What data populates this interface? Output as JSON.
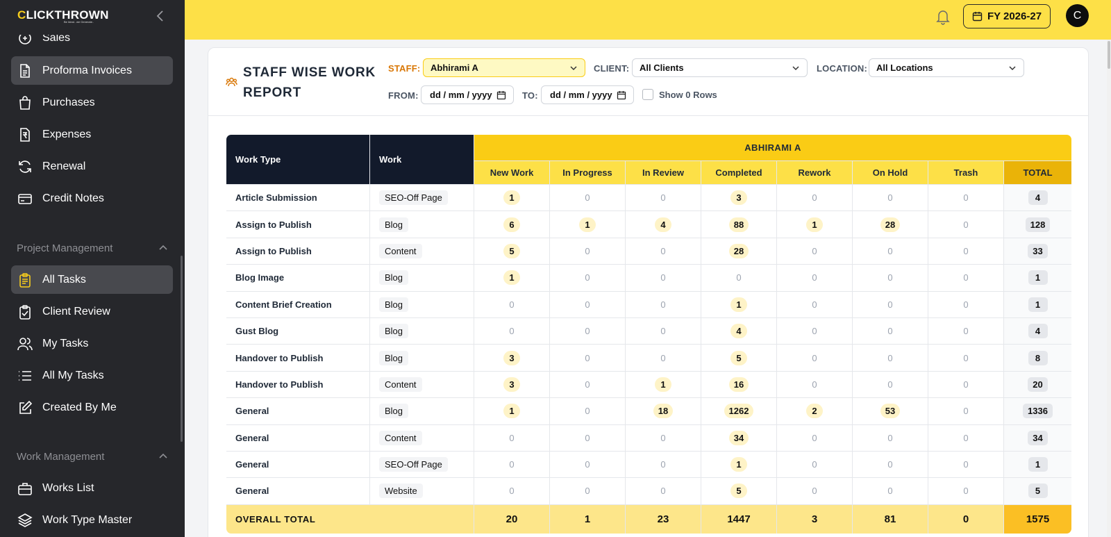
{
  "brand": {
    "logo_first": "C",
    "logo_rest": "LICKTHROWN",
    "tagline": "Be Ideal.. we Generate.."
  },
  "sidebar": {
    "partial_item": "Sales",
    "items_top": [
      {
        "label": "Proforma Invoices",
        "icon": "document-icon",
        "active": true
      },
      {
        "label": "Purchases",
        "icon": "shopping-bag-icon"
      },
      {
        "label": "Expenses",
        "icon": "rupee-receipt-icon"
      },
      {
        "label": "Renewal",
        "icon": "refresh-icon"
      },
      {
        "label": "Credit Notes",
        "icon": "credit-card-icon"
      }
    ],
    "sections": [
      {
        "label": "Project Management",
        "items": [
          {
            "label": "All Tasks",
            "icon": "clipboard-icon",
            "active": true
          },
          {
            "label": "Client Review",
            "icon": "clipboard-check-icon"
          },
          {
            "label": "My Tasks",
            "icon": "users-icon"
          },
          {
            "label": "All My Tasks",
            "icon": "list-icon"
          },
          {
            "label": "Created By Me",
            "icon": "edit-icon"
          }
        ]
      },
      {
        "label": "Work Management",
        "items": [
          {
            "label": "Works List",
            "icon": "briefcase-icon"
          },
          {
            "label": "Work Type Master",
            "icon": "layers-icon"
          }
        ]
      }
    ]
  },
  "topbar": {
    "fy_label": "FY 2026-27",
    "avatar_initial": "C"
  },
  "page": {
    "title": "STAFF WISE WORK REPORT",
    "filters": {
      "staff_label": "STAFF:",
      "staff_value": "Abhirami A",
      "client_label": "CLIENT:",
      "client_value": "All Clients",
      "location_label": "LOCATION:",
      "location_value": "All Locations",
      "from_label": "FROM:",
      "from_value": "dd / mm / yyyy",
      "to_label": "TO:",
      "to_value": "dd / mm / yyyy",
      "show_zero_label": "Show 0 Rows"
    }
  },
  "table": {
    "col_work_type": "Work Type",
    "col_work": "Work",
    "staff_name": "ABHIRAMI A",
    "status_columns": [
      "New Work",
      "In Progress",
      "In Review",
      "Completed",
      "Rework",
      "On Hold",
      "Trash",
      "TOTAL"
    ],
    "rows": [
      {
        "work_type": "Article Submission",
        "work": "SEO-Off Page",
        "values": [
          1,
          0,
          0,
          3,
          0,
          0,
          0
        ],
        "total": 4
      },
      {
        "work_type": "Assign to Publish",
        "work": "Blog",
        "values": [
          6,
          1,
          4,
          88,
          1,
          28,
          0
        ],
        "total": 128
      },
      {
        "work_type": "Assign to Publish",
        "work": "Content",
        "values": [
          5,
          0,
          0,
          28,
          0,
          0,
          0
        ],
        "total": 33
      },
      {
        "work_type": "Blog Image",
        "work": "Blog",
        "values": [
          1,
          0,
          0,
          0,
          0,
          0,
          0
        ],
        "total": 1
      },
      {
        "work_type": "Content Brief Creation",
        "work": "Blog",
        "values": [
          0,
          0,
          0,
          1,
          0,
          0,
          0
        ],
        "total": 1
      },
      {
        "work_type": "Gust Blog",
        "work": "Blog",
        "values": [
          0,
          0,
          0,
          4,
          0,
          0,
          0
        ],
        "total": 4
      },
      {
        "work_type": "Handover to Publish",
        "work": "Blog",
        "values": [
          3,
          0,
          0,
          5,
          0,
          0,
          0
        ],
        "total": 8
      },
      {
        "work_type": "Handover to Publish",
        "work": "Content",
        "values": [
          3,
          0,
          1,
          16,
          0,
          0,
          0
        ],
        "total": 20
      },
      {
        "work_type": "General",
        "work": "Blog",
        "values": [
          1,
          0,
          18,
          1262,
          2,
          53,
          0
        ],
        "total": 1336
      },
      {
        "work_type": "General",
        "work": "Content",
        "values": [
          0,
          0,
          0,
          34,
          0,
          0,
          0
        ],
        "total": 34
      },
      {
        "work_type": "General",
        "work": "SEO-Off Page",
        "values": [
          0,
          0,
          0,
          1,
          0,
          0,
          0
        ],
        "total": 1
      },
      {
        "work_type": "General",
        "work": "Website",
        "values": [
          0,
          0,
          0,
          5,
          0,
          0,
          0
        ],
        "total": 5
      }
    ],
    "footer": {
      "label": "OVERALL TOTAL",
      "values": [
        20,
        1,
        23,
        1447,
        3,
        81,
        0
      ],
      "total": 1575
    }
  },
  "colors": {
    "topbar": "#fde047",
    "sidebar": "#26272b",
    "accent": "#facc15",
    "header_dark": "#121a2b"
  }
}
